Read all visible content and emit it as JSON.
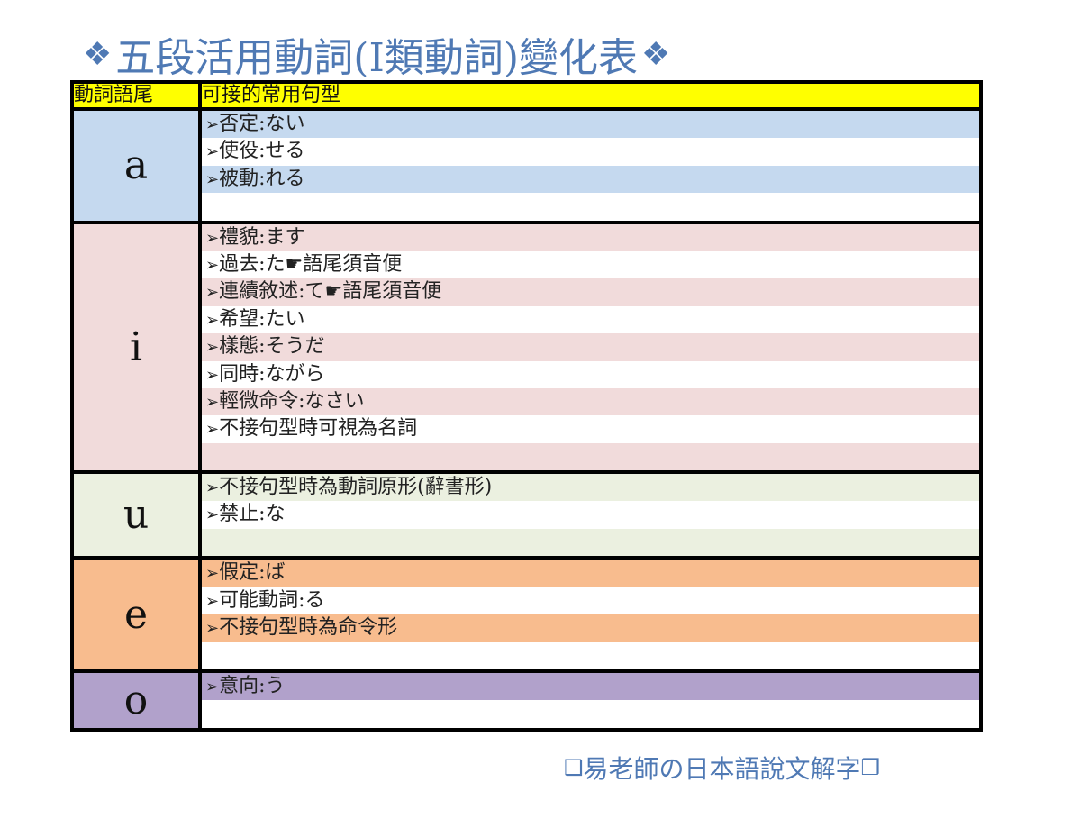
{
  "title": {
    "diamond": "❖",
    "text": "五段活用動詞(I類動詞)變化表"
  },
  "table": {
    "header": {
      "col1": "動詞語尾",
      "col2": "可接的常用句型"
    },
    "arrow": "➢",
    "groups": [
      {
        "ending": "a",
        "lines": [
          "否定:ない",
          "使役:せる",
          "被動:れる",
          ""
        ]
      },
      {
        "ending": "i",
        "lines": [
          "禮貌:ます",
          "過去:た☛語尾須音便",
          "連續敘述:て☛語尾須音便",
          "希望:たい",
          "樣態:そうだ",
          "同時:ながら",
          "輕微命令:なさい",
          "不接句型時可視為名詞",
          ""
        ]
      },
      {
        "ending": "u",
        "lines": [
          "不接句型時為動詞原形(辭書形)",
          "禁止:な",
          ""
        ]
      },
      {
        "ending": "e",
        "lines": [
          "假定:ば",
          "可能動詞:る",
          "不接句型時為命令形",
          ""
        ]
      },
      {
        "ending": "o",
        "lines": [
          "意向:う",
          ""
        ]
      }
    ]
  },
  "footer": {
    "left_box": "❑",
    "text": "易老師の日本語說文解字",
    "right_box": "❒"
  },
  "colors": {
    "title": "#4f79b4",
    "header": "#ffff00",
    "a": "#c5d9ef",
    "i": "#f1dbdb",
    "u": "#ebf0e0",
    "e": "#f8bc8e",
    "o": "#b1a1cb"
  }
}
